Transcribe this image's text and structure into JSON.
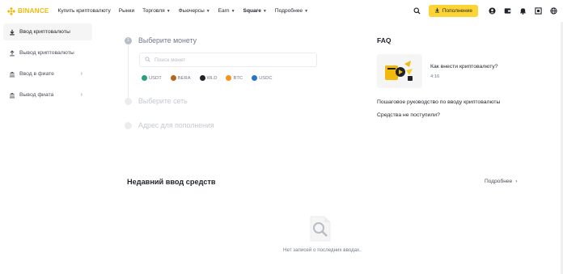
{
  "header": {
    "logo_text": "BINANCE",
    "nav": [
      {
        "label": "Купить криптовалюту",
        "dropdown": false
      },
      {
        "label": "Рынки",
        "dropdown": false
      },
      {
        "label": "Торговля",
        "dropdown": true
      },
      {
        "label": "Фьючерсы",
        "dropdown": true
      },
      {
        "label": "Earn",
        "dropdown": true
      },
      {
        "label": "Square",
        "dropdown": true
      },
      {
        "label": "Подробнее",
        "dropdown": true
      }
    ],
    "deposit_label": "Пополнение",
    "icons": [
      "search-icon",
      "download-icon",
      "user-icon",
      "wallet-icon",
      "bell-icon",
      "qr-icon",
      "globe-icon"
    ]
  },
  "sidebar": {
    "items": [
      {
        "label": "Ввод криптовалюты",
        "icon": "download-icon",
        "active": true
      },
      {
        "label": "Вывод криптовалюты",
        "icon": "upload-icon",
        "active": false
      },
      {
        "label": "Ввод в фиате",
        "icon": "bank-icon",
        "active": false,
        "arrow": "›"
      },
      {
        "label": "Вывод фиата",
        "icon": "bank-icon",
        "active": false,
        "arrow": "›"
      }
    ]
  },
  "steps": {
    "step1_label": "Выберите монету",
    "step1_number": "1",
    "search_placeholder": "Поиск монет",
    "coins": [
      {
        "name": "USDT",
        "color": "#26a17b"
      },
      {
        "name": "BERA",
        "color": "#b5651d"
      },
      {
        "name": "WLD",
        "color": "#1e2329"
      },
      {
        "name": "BTC",
        "color": "#f7931a"
      },
      {
        "name": "USDC",
        "color": "#2775ca"
      }
    ],
    "step2_label": "Выберите сеть",
    "step3_label": "Адрес для пополнения"
  },
  "faq": {
    "title": "FAQ",
    "video_title": "Как внести криптовалюту?",
    "video_duration": "4:16",
    "links": [
      "Пошаговое руководство по вводу криптовалюты",
      "Средства не поступили?"
    ]
  },
  "recent": {
    "title": "Недавний ввод средств",
    "more_label": "Подробнее",
    "more_arrow": "›",
    "empty_text": "Нет записей о последних вводах."
  },
  "colors": {
    "brand": "#f0b90b",
    "button": "#fcd535"
  }
}
